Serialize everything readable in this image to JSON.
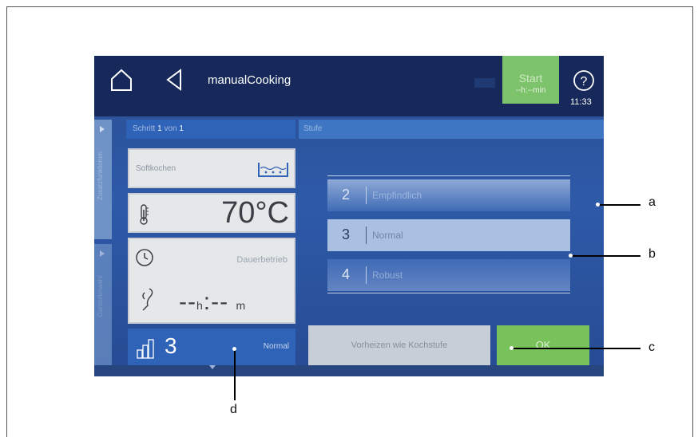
{
  "header": {
    "title": "manualCooking",
    "start": {
      "label": "Start",
      "sub": "--h:--min"
    },
    "clock": "11:33"
  },
  "sidebar": {
    "tab1": "Zusatzfunktionen",
    "tab2": "Garstufenwahl"
  },
  "program": {
    "step_label": "Schritt",
    "step_current": "1",
    "step_of": "von",
    "step_total": "1",
    "name": "Softkochen",
    "temperature": "70°C",
    "time_mode": "Dauerbetrieb",
    "duration_h": "--",
    "duration_h_unit": "h",
    "duration_sep": ":",
    "duration_m": "--",
    "duration_m_unit": "m",
    "stage_value": "3",
    "stage_name": "Normal"
  },
  "panel": {
    "heading": "Stufe",
    "options": [
      {
        "num": "2",
        "label": "Empfindlich"
      },
      {
        "num": "3",
        "label": "Normal"
      },
      {
        "num": "4",
        "label": "Robust"
      }
    ],
    "selected": "3",
    "preheat_label": "Vorheizen wie Kochstufe",
    "ok_label": "OK"
  },
  "callouts": {
    "a": "a",
    "b": "b",
    "c": "c",
    "d": "d"
  },
  "colors": {
    "topbar": "#16295a",
    "screen": "#2e5aa8",
    "start_green": "#7dc36b",
    "ok_green": "#79c25b",
    "selected_row": "#a9c0e2"
  }
}
